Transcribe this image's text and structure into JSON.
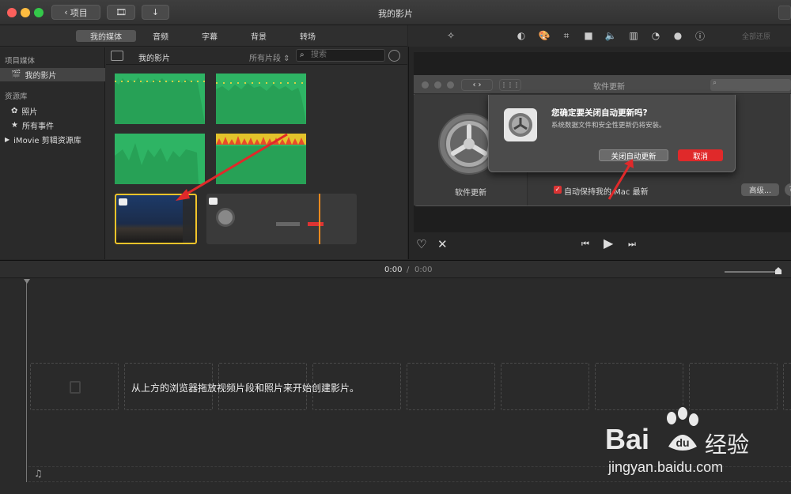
{
  "window": {
    "title": "我的影片",
    "back_label": "项目"
  },
  "browser_tabs": [
    "我的媒体",
    "音频",
    "字幕",
    "背景",
    "转场"
  ],
  "sidebar": {
    "section1": "项目媒体",
    "project_item": "我的影片",
    "section2": "资源库",
    "items": [
      "照片",
      "所有事件",
      "iMovie 剪辑资源库"
    ]
  },
  "library": {
    "title": "我的影片",
    "filter": "所有片段",
    "search_placeholder": "搜索"
  },
  "viewer": {
    "reset_label": "全部还原"
  },
  "embedded": {
    "window_title": "软件更新",
    "search_placeholder": "",
    "pane_label": "软件更新",
    "checkbox_label": "自动保持我的 Mac 最新",
    "advanced_label": "高级...",
    "help_label": "?",
    "dialog_title": "您确定要关闭自动更新吗?",
    "dialog_text": "系统数据文件和安全性更新仍将安装。",
    "confirm_label": "关闭自动更新",
    "cancel_label": "取消"
  },
  "timeline": {
    "time_current": "0:00",
    "time_sep": "/",
    "time_total": "0:00",
    "hint": "从上方的浏览器拖放视频片段和照片来开始创建影片。"
  },
  "watermark": {
    "brand": "Bai",
    "brand2": "经验",
    "url": "jingyan.baidu.com"
  },
  "colors": {
    "accent_red": "#e0292a",
    "clip_green": "#2eb464",
    "selection_yellow": "#f3c42a"
  }
}
